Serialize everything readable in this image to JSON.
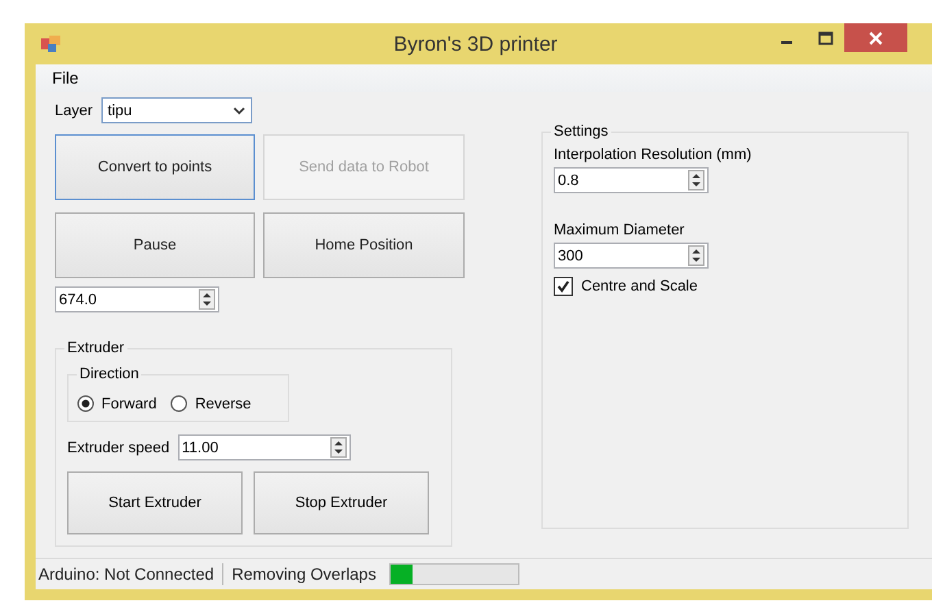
{
  "window": {
    "title": "Byron's 3D printer"
  },
  "menu": [
    "File"
  ],
  "layer": {
    "label": "Layer",
    "value": "tipu"
  },
  "buttons": [
    {
      "label": "Convert to points",
      "disabled": false,
      "focused": true
    },
    {
      "label": "Send data to Robot",
      "disabled": true,
      "focused": false
    },
    {
      "label": "Pause",
      "disabled": false,
      "focused": false
    },
    {
      "label": "Home Position",
      "disabled": false,
      "focused": false
    }
  ],
  "position": {
    "value": "674.0"
  },
  "extruder": {
    "title": "Extruder",
    "direction": {
      "title": "Direction",
      "options": [
        {
          "label": "Forward",
          "selected": true
        },
        {
          "label": "Reverse",
          "selected": false
        }
      ]
    },
    "speed": {
      "label": "Extruder speed",
      "value": "11.00"
    },
    "buttons": [
      "Start Extruder",
      "Stop Extruder"
    ]
  },
  "settings": {
    "title": "Settings",
    "fields": [
      {
        "label": "Interpolation Resolution (mm)",
        "value": "0.8"
      },
      {
        "label": "Maximum Diameter",
        "value": "300"
      }
    ],
    "checkbox": {
      "label": "Centre and Scale",
      "checked": true
    }
  },
  "status_bar": {
    "items": [
      "Arduino: Not Connected",
      "Removing Overlaps"
    ],
    "progress": {
      "level": 0.17
    }
  }
}
